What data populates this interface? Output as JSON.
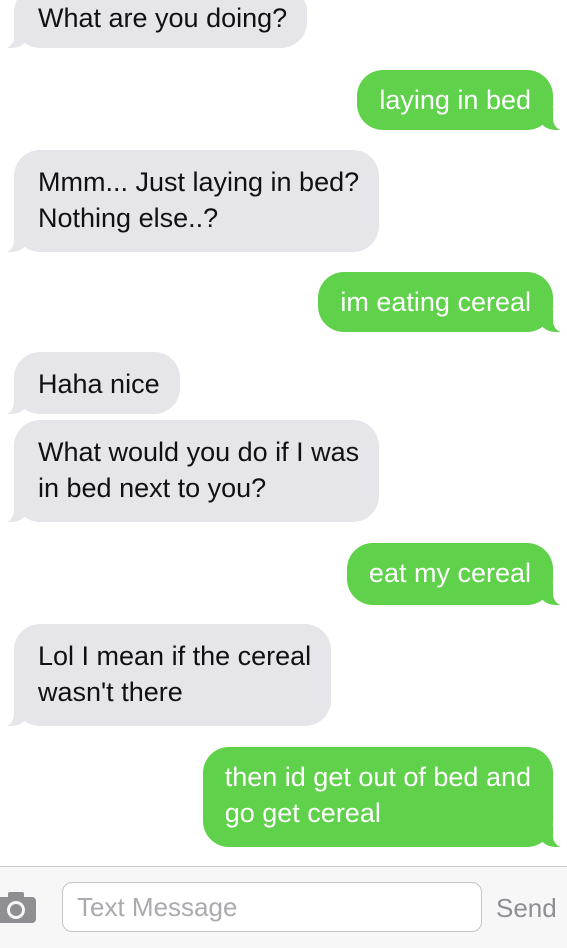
{
  "conversation": {
    "messages": [
      {
        "sender": "them",
        "text": "What are you doing?"
      },
      {
        "sender": "me",
        "text": "laying in bed"
      },
      {
        "sender": "them",
        "text": "Mmm... Just laying in bed?\nNothing else..?"
      },
      {
        "sender": "me",
        "text": "im eating cereal"
      },
      {
        "sender": "them",
        "text": "Haha nice"
      },
      {
        "sender": "them",
        "text": "What would you do if I was\nin bed next to you?"
      },
      {
        "sender": "me",
        "text": "eat my cereal"
      },
      {
        "sender": "them",
        "text": "Lol I mean if the cereal\nwasn't there"
      },
      {
        "sender": "me",
        "text": "then id get out of bed and\ngo get cereal"
      }
    ]
  },
  "composer": {
    "camera_icon": "camera-icon",
    "placeholder": "Text Message",
    "send_label": "Send"
  },
  "colors": {
    "sent_bubble": "#5fd14a",
    "received_bubble": "#e5e5ea"
  }
}
